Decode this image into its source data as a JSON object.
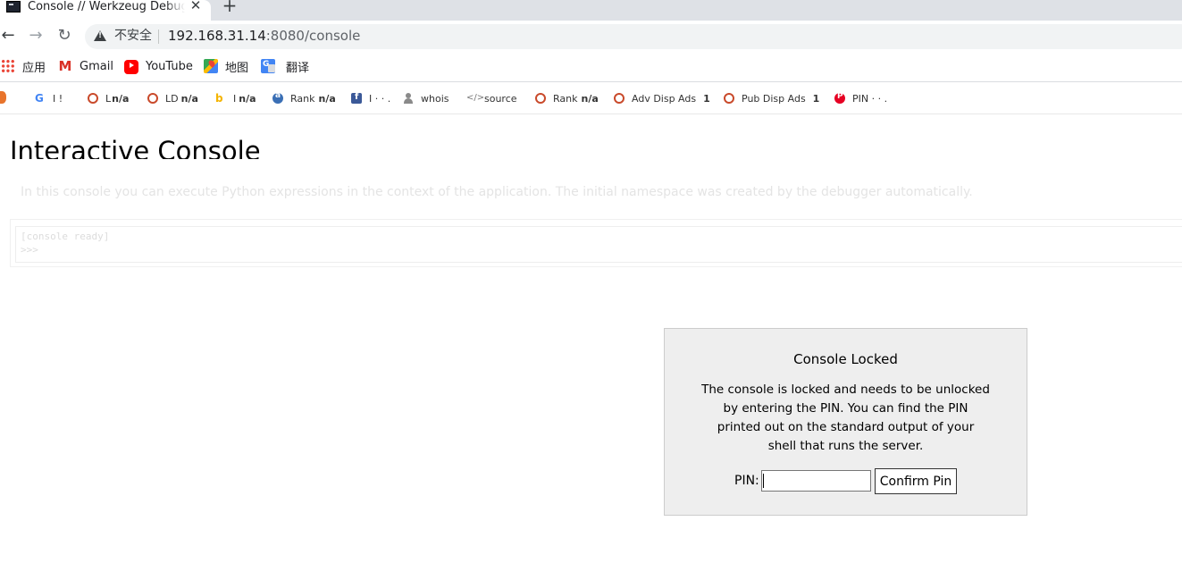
{
  "browser": {
    "tab": {
      "title": "Console // Werkzeug Debugger",
      "favicon": "terminal-icon",
      "close_glyph": "✕"
    },
    "new_tab_glyph": "+",
    "nav": {
      "back_glyph": "←",
      "forward_glyph": "→",
      "reload_glyph": "↻"
    },
    "address": {
      "security_label": "不安全",
      "host": "192.168.31.14",
      "path": ":8080/console"
    }
  },
  "bookmarks": [
    {
      "label": "应用",
      "icon": "apps-grid-icon"
    },
    {
      "label": "Gmail",
      "icon": "gmail-icon"
    },
    {
      "label": "YouTube",
      "icon": "youtube-icon"
    },
    {
      "label": "地图",
      "icon": "maps-icon"
    },
    {
      "label": "翻译",
      "icon": "translate-icon"
    }
  ],
  "seo_toolbar": [
    {
      "label": "I !",
      "value": "",
      "icon": "google-icon"
    },
    {
      "label": "L",
      "value": "n/a",
      "icon": "circle-icon"
    },
    {
      "label": "LD",
      "value": "n/a",
      "icon": "circle-icon"
    },
    {
      "label": "I",
      "value": "n/a",
      "icon": "bing-icon"
    },
    {
      "label": "Rank",
      "value": "n/a",
      "icon": "alexa-icon"
    },
    {
      "label": "I · · .",
      "value": "",
      "icon": "facebook-icon"
    },
    {
      "label": "whois",
      "value": "",
      "icon": "user-icon"
    },
    {
      "label": "source",
      "value": "",
      "icon": "code-icon"
    },
    {
      "label": "Rank",
      "value": "n/a",
      "icon": "circle-icon"
    },
    {
      "label": "Adv Disp Ads",
      "value": "1",
      "icon": "circle-icon"
    },
    {
      "label": "Pub Disp Ads",
      "value": "1",
      "icon": "circle-icon"
    },
    {
      "label": "PIN · · .",
      "value": "",
      "icon": "pinterest-icon"
    }
  ],
  "page": {
    "title": "Interactive Console",
    "intro": "In this console you can execute Python expressions in the context of the application. The initial namespace was created by the debugger automatically.",
    "console": {
      "ready": "[console ready]",
      "prompt": ">>>"
    }
  },
  "pin_prompt": {
    "title": "Console Locked",
    "text_lines": [
      "The console is locked and needs to be unlocked",
      "by entering the PIN. You can find the PIN",
      "printed out on the standard output of your",
      "shell that runs the server."
    ],
    "pin_label": "PIN:",
    "pin_value": "",
    "button_label": "Confirm Pin"
  }
}
